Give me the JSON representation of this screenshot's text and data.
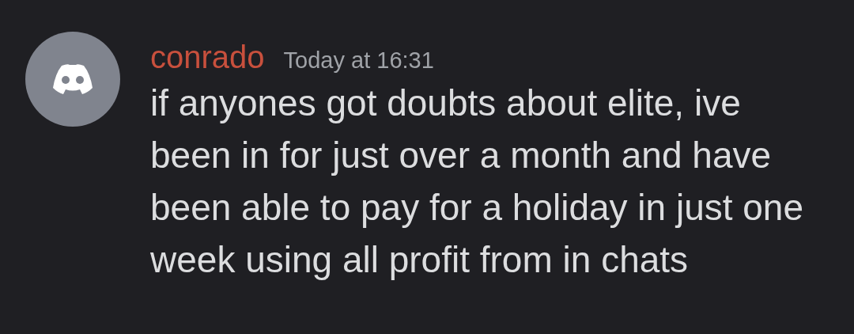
{
  "message": {
    "author": "conrado",
    "timestamp": "Today at 16:31",
    "text": "if anyones got doubts about elite, ive been in for just over a month and have been able to pay for a holiday in just one week using all profit from in chats"
  }
}
